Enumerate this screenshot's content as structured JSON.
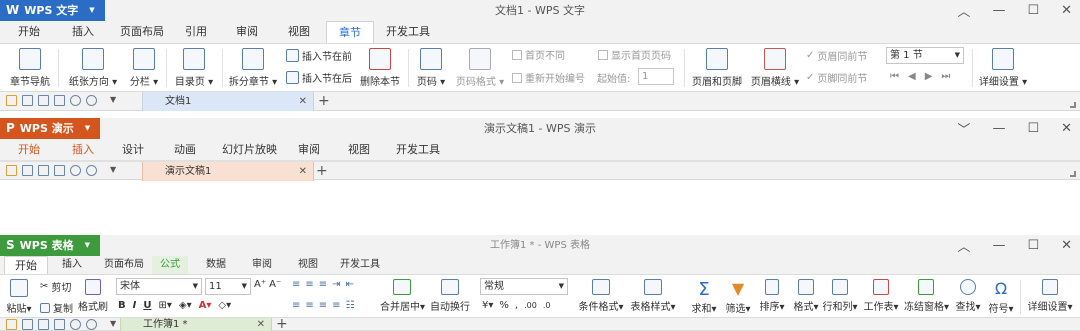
{
  "writer": {
    "brand": "WPS 文字",
    "title": "文档1 - WPS 文字",
    "color": "#2b6cc4",
    "tabs": [
      "开始",
      "插入",
      "页面布局",
      "引用",
      "审阅",
      "视图",
      "章节",
      "开发工具"
    ],
    "active_tab": "章节",
    "ribbon": {
      "nav": "章节导航",
      "orient": "纸张方向",
      "columns": "分栏",
      "toc": "目录页",
      "split": "拆分章节",
      "ins_before": "插入节在前",
      "ins_after": "插入节在后",
      "del_section": "删除本节",
      "page_num": "页码",
      "page_fmt": "页码格式",
      "first_diff": "首页不同",
      "show_first": "显示首页页码",
      "restart": "重新开始编号",
      "start_label": "起始值:",
      "start_value": "1",
      "header_footer": "页眉和页脚",
      "header_line": "页眉横线",
      "same_prev1": "页眉同前节",
      "same_prev2": "页脚同前节",
      "section_select": "第 1 节",
      "detail": "详细设置"
    },
    "doc_tab": "文档1"
  },
  "presentation": {
    "brand": "WPS 演示",
    "title": "演示文稿1 - WPS 演示",
    "color": "#d4561e",
    "tabs": [
      "开始",
      "插入",
      "设计",
      "动画",
      "幻灯片放映",
      "审阅",
      "视图",
      "开发工具"
    ],
    "doc_tab": "演示文稿1"
  },
  "spreadsheet": {
    "brand": "WPS 表格",
    "title": "工作簿1 * - WPS 表格",
    "color": "#3d9a3d",
    "tabs": [
      "开始",
      "插入",
      "页面布局",
      "公式",
      "数据",
      "审阅",
      "视图",
      "开发工具"
    ],
    "active_tab": "开始",
    "ribbon": {
      "paste": "粘贴",
      "cut": "剪切",
      "copy": "复制",
      "format_painter": "格式刷",
      "font": "宋体",
      "size": "11",
      "merge": "合并居中",
      "wrap": "自动换行",
      "num_format": "常规",
      "cond_format": "条件格式",
      "table_style": "表格样式",
      "sum": "求和",
      "filter": "筛选",
      "sort": "排序",
      "format": "格式",
      "rowcol": "行和列",
      "sheet": "工作表",
      "freeze": "冻结窗格",
      "find": "查找",
      "symbol": "符号",
      "detail": "详细设置",
      "percent": "%"
    },
    "doc_tab": "工作簿1 *"
  },
  "win_controls": {
    "min": "—",
    "max": "☐",
    "close": "✕",
    "collapse": "⌃"
  }
}
